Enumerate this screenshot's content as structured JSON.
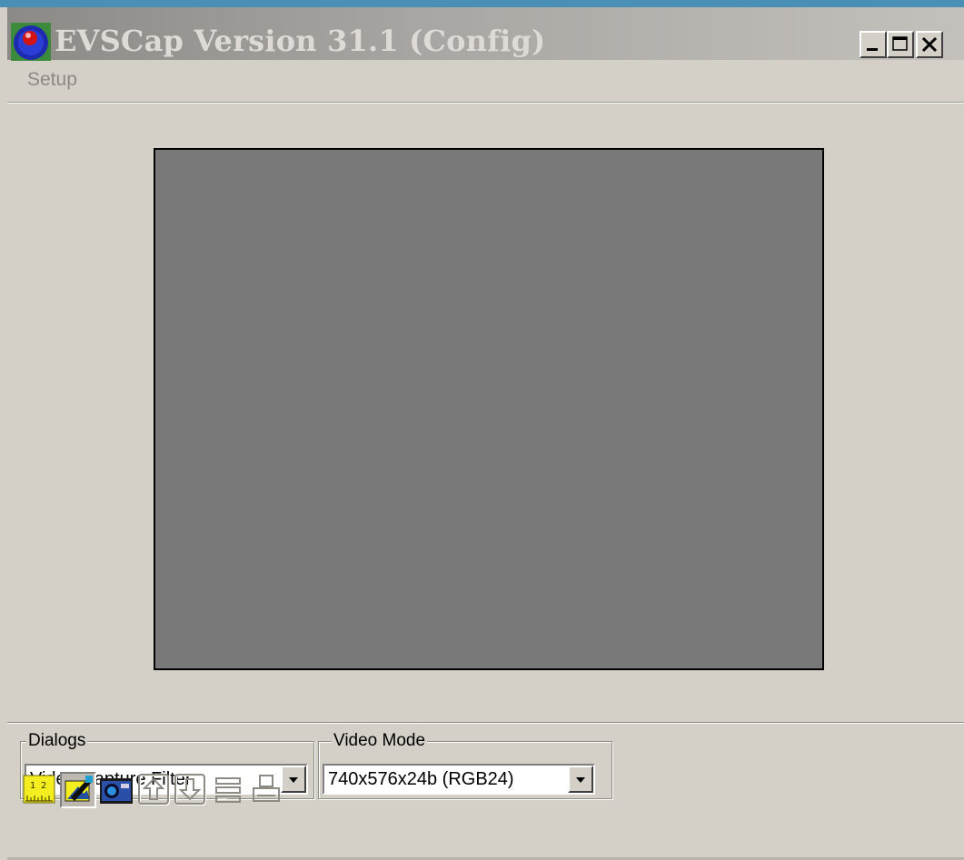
{
  "window": {
    "title": "EVSCap Version 31.1 (Config)",
    "icon": "evscap-app-icon",
    "controls": {
      "minimize": "minimize-icon",
      "maximize": "maximize-icon",
      "close": "close-icon"
    }
  },
  "menu": {
    "items": [
      "Setup"
    ]
  },
  "dialogs": {
    "label": "Dialogs",
    "selected": "Video Capture Filter"
  },
  "video_mode": {
    "label": "Video Mode",
    "selected": "740x576x24b (RGB24)"
  },
  "toolbar": {
    "buttons": [
      {
        "icon": "ruler-icon",
        "enabled": true,
        "pressed": false
      },
      {
        "icon": "edit-picture-icon",
        "enabled": true,
        "pressed": true
      },
      {
        "icon": "camera-capture-icon",
        "enabled": true,
        "pressed": false
      },
      {
        "icon": "upload-icon",
        "enabled": false,
        "pressed": false
      },
      {
        "icon": "download-icon",
        "enabled": false,
        "pressed": false
      },
      {
        "icon": "list-icon",
        "enabled": false,
        "pressed": false
      },
      {
        "icon": "print-icon",
        "enabled": false,
        "pressed": false
      }
    ]
  },
  "colors": {
    "title_gradient_start": "#8c8a86",
    "title_text": "#dedbd6",
    "face": "#d4d0c8",
    "video_preview": "#797979",
    "disabled_text": "#8d8a85"
  }
}
